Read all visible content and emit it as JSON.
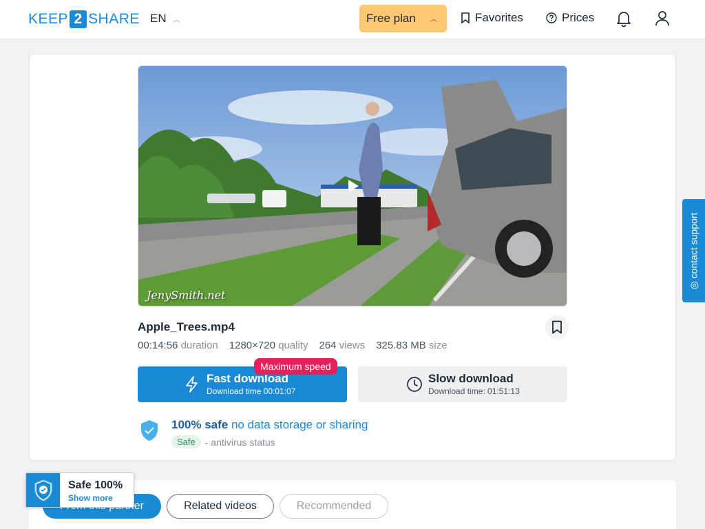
{
  "header": {
    "logo_left": "KEEP",
    "logo_mid": "2",
    "logo_right": "SHARE",
    "language": "EN",
    "plan_label": "Free plan",
    "favorites_label": "Favorites",
    "prices_label": "Prices"
  },
  "file": {
    "name": "Apple_Trees.mp4",
    "watermark": "JenySmith.net",
    "duration_value": "00:14:56",
    "duration_label": "duration",
    "quality_value": "1280×720",
    "quality_label": "quality",
    "views_value": "264",
    "views_label": "views",
    "size_value": "325.83 MB",
    "size_label": "size"
  },
  "download": {
    "fast_title": "Fast download",
    "fast_sub": "Download time 00:01:07",
    "max_speed_badge": "Maximum speed",
    "slow_title": "Slow download",
    "slow_sub": "Download time: 01:51:13"
  },
  "safety": {
    "headline_bold": "100% safe",
    "headline_rest": "no data storage or sharing",
    "status_pill": "Safe",
    "status_text": "- antivirus status"
  },
  "tabs": [
    {
      "label": "From this partner"
    },
    {
      "label": "Related videos"
    },
    {
      "label": "Recommended"
    }
  ],
  "safe_badge": {
    "title": "Safe 100%",
    "link": "Show more"
  },
  "contact_support": "contact support",
  "colors": {
    "accent": "#1a8ad6",
    "plan": "#fcc873",
    "badge": "#e5205a"
  }
}
